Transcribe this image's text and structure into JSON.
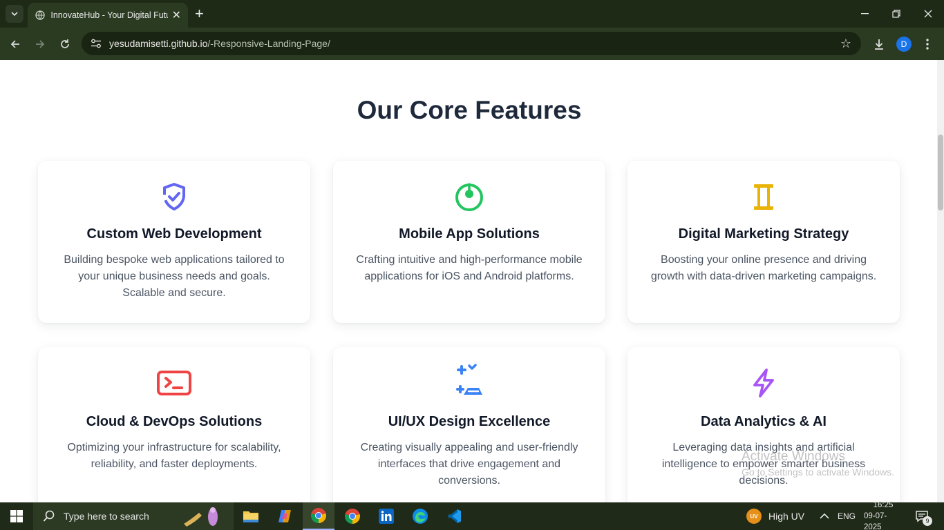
{
  "browser": {
    "tab_title": "InnovateHub - Your Digital Futu",
    "url_host": "yesudamisetti.github.io",
    "url_path": "/-Responsive-Landing-Page/",
    "profile_initial": "D"
  },
  "page": {
    "section_title": "Our Core Features",
    "features": [
      {
        "icon": "shield-check-icon",
        "icon_color": "#6366f1",
        "title": "Custom Web Development",
        "description": "Building bespoke web applications tailored to your unique business needs and goals. Scalable and secure."
      },
      {
        "icon": "power-ring-icon",
        "icon_color": "#22c55e",
        "title": "Mobile App Solutions",
        "description": "Crafting intuitive and high-performance mobile applications for iOS and Android platforms."
      },
      {
        "icon": "pillar-icon",
        "icon_color": "#eab308",
        "title": "Digital Marketing Strategy",
        "description": "Boosting your online presence and driving growth with data-driven marketing campaigns."
      },
      {
        "icon": "terminal-icon",
        "icon_color": "#ef4444",
        "title": "Cloud & DevOps Solutions",
        "description": "Optimizing your infrastructure for scalability, reliability, and faster deployments."
      },
      {
        "icon": "design-tools-icon",
        "icon_color": "#3b82f6",
        "title": "UI/UX Design Excellence",
        "description": "Creating visually appealing and user-friendly interfaces that drive engagement and conversions."
      },
      {
        "icon": "lightning-icon",
        "icon_color": "#a855f7",
        "title": "Data Analytics & AI",
        "description": "Leveraging data insights and artificial intelligence to empower smarter business decisions."
      }
    ],
    "watermark_title": "Activate Windows",
    "watermark_sub": "Go to Settings to activate Windows."
  },
  "taskbar": {
    "search_placeholder": "Type here to search",
    "weather": "High UV",
    "weather_badge": "UV",
    "language": "ENG",
    "time": "16:25",
    "date": "09-07-2025",
    "notification_count": "9"
  }
}
